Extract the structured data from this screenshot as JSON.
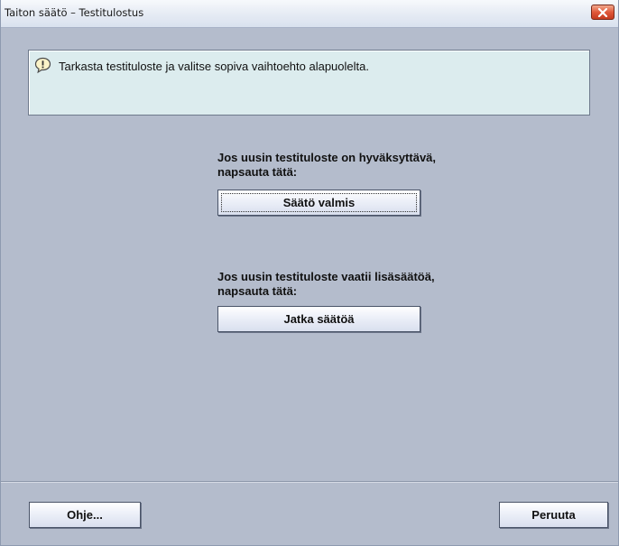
{
  "window": {
    "title": "Taiton säätö – Testitulostus",
    "close_icon": "close-icon"
  },
  "info": {
    "icon": "speech-bubble-exclamation-icon",
    "text": "Tarkasta testituloste ja valitse sopiva vaihtoehto alapuolelta."
  },
  "option_done": {
    "prompt_line1": "Jos uusin testituloste on hyväksyttävä,",
    "prompt_line2": "napsauta tätä:",
    "button_label": "Säätö valmis"
  },
  "option_continue": {
    "prompt_line1": "Jos uusin testituloste vaatii lisäsäätöä,",
    "prompt_line2": "napsauta tätä:",
    "button_label": "Jatka säätöä"
  },
  "footer": {
    "help_label": "Ohje...",
    "cancel_label": "Peruuta"
  },
  "colors": {
    "dialog_background": "#b4bccc",
    "info_background": "#dcecee",
    "close_button": "#e0583a"
  }
}
